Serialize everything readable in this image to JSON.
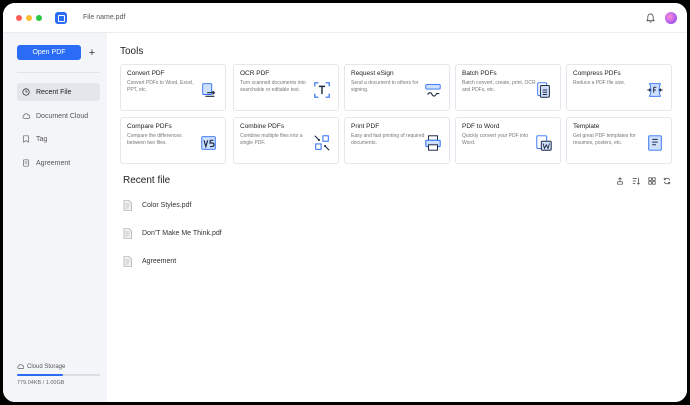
{
  "window": {
    "file_title": "File name.pdf"
  },
  "sidebar": {
    "open_button": "Open PDF",
    "plus_label": "+",
    "items": [
      {
        "label": "Recent File",
        "icon": "clock-icon",
        "active": true
      },
      {
        "label": "Document Cloud",
        "icon": "cloud-icon",
        "active": false
      },
      {
        "label": "Tag",
        "icon": "tag-icon",
        "active": false
      },
      {
        "label": "Agreement",
        "icon": "document-icon",
        "active": false
      }
    ],
    "storage": {
      "label": "Cloud Storage",
      "value": "779.04KB / 1.00GB",
      "used_fraction": 0.55
    }
  },
  "main": {
    "tools_title": "Tools",
    "tools": [
      {
        "title": "Convert PDF",
        "desc": "Convert PDFs to Word, Excel, PPT, etc.",
        "icon": "convert-icon"
      },
      {
        "title": "OCR PDF",
        "desc": "Turn scanned documents into searchable or editable text.",
        "icon": "ocr-icon"
      },
      {
        "title": "Request eSign",
        "desc": "Send a document to others for signing.",
        "icon": "esign-icon"
      },
      {
        "title": "Batch PDFs",
        "desc": "Batch convert, create, print, OCR and PDFs, etc.",
        "icon": "batch-icon"
      },
      {
        "title": "Compress PDFs",
        "desc": "Reduce a PDF file size.",
        "icon": "compress-icon"
      },
      {
        "title": "Compare PDFs",
        "desc": "Compare the differences between two files.",
        "icon": "compare-icon"
      },
      {
        "title": "Combine PDFs",
        "desc": "Combine multiple files into a single PDF.",
        "icon": "combine-icon"
      },
      {
        "title": "Print PDF",
        "desc": "Easy and fast printing of required documents.",
        "icon": "print-icon"
      },
      {
        "title": "PDF to Word",
        "desc": "Quickly convert your PDF into Word.",
        "icon": "pdf-to-word-icon"
      },
      {
        "title": "Template",
        "desc": "Get great PDF templates for resumes, posters, etc.",
        "icon": "template-icon"
      }
    ],
    "recent_title": "Recent file",
    "recent_files": [
      {
        "name": "Color Styles.pdf"
      },
      {
        "name": "Don'T Make Me Think.pdf"
      },
      {
        "name": "Agreement"
      }
    ]
  },
  "colors": {
    "accent": "#2a6cf6",
    "sidebar_bg": "#f4f5f8"
  }
}
